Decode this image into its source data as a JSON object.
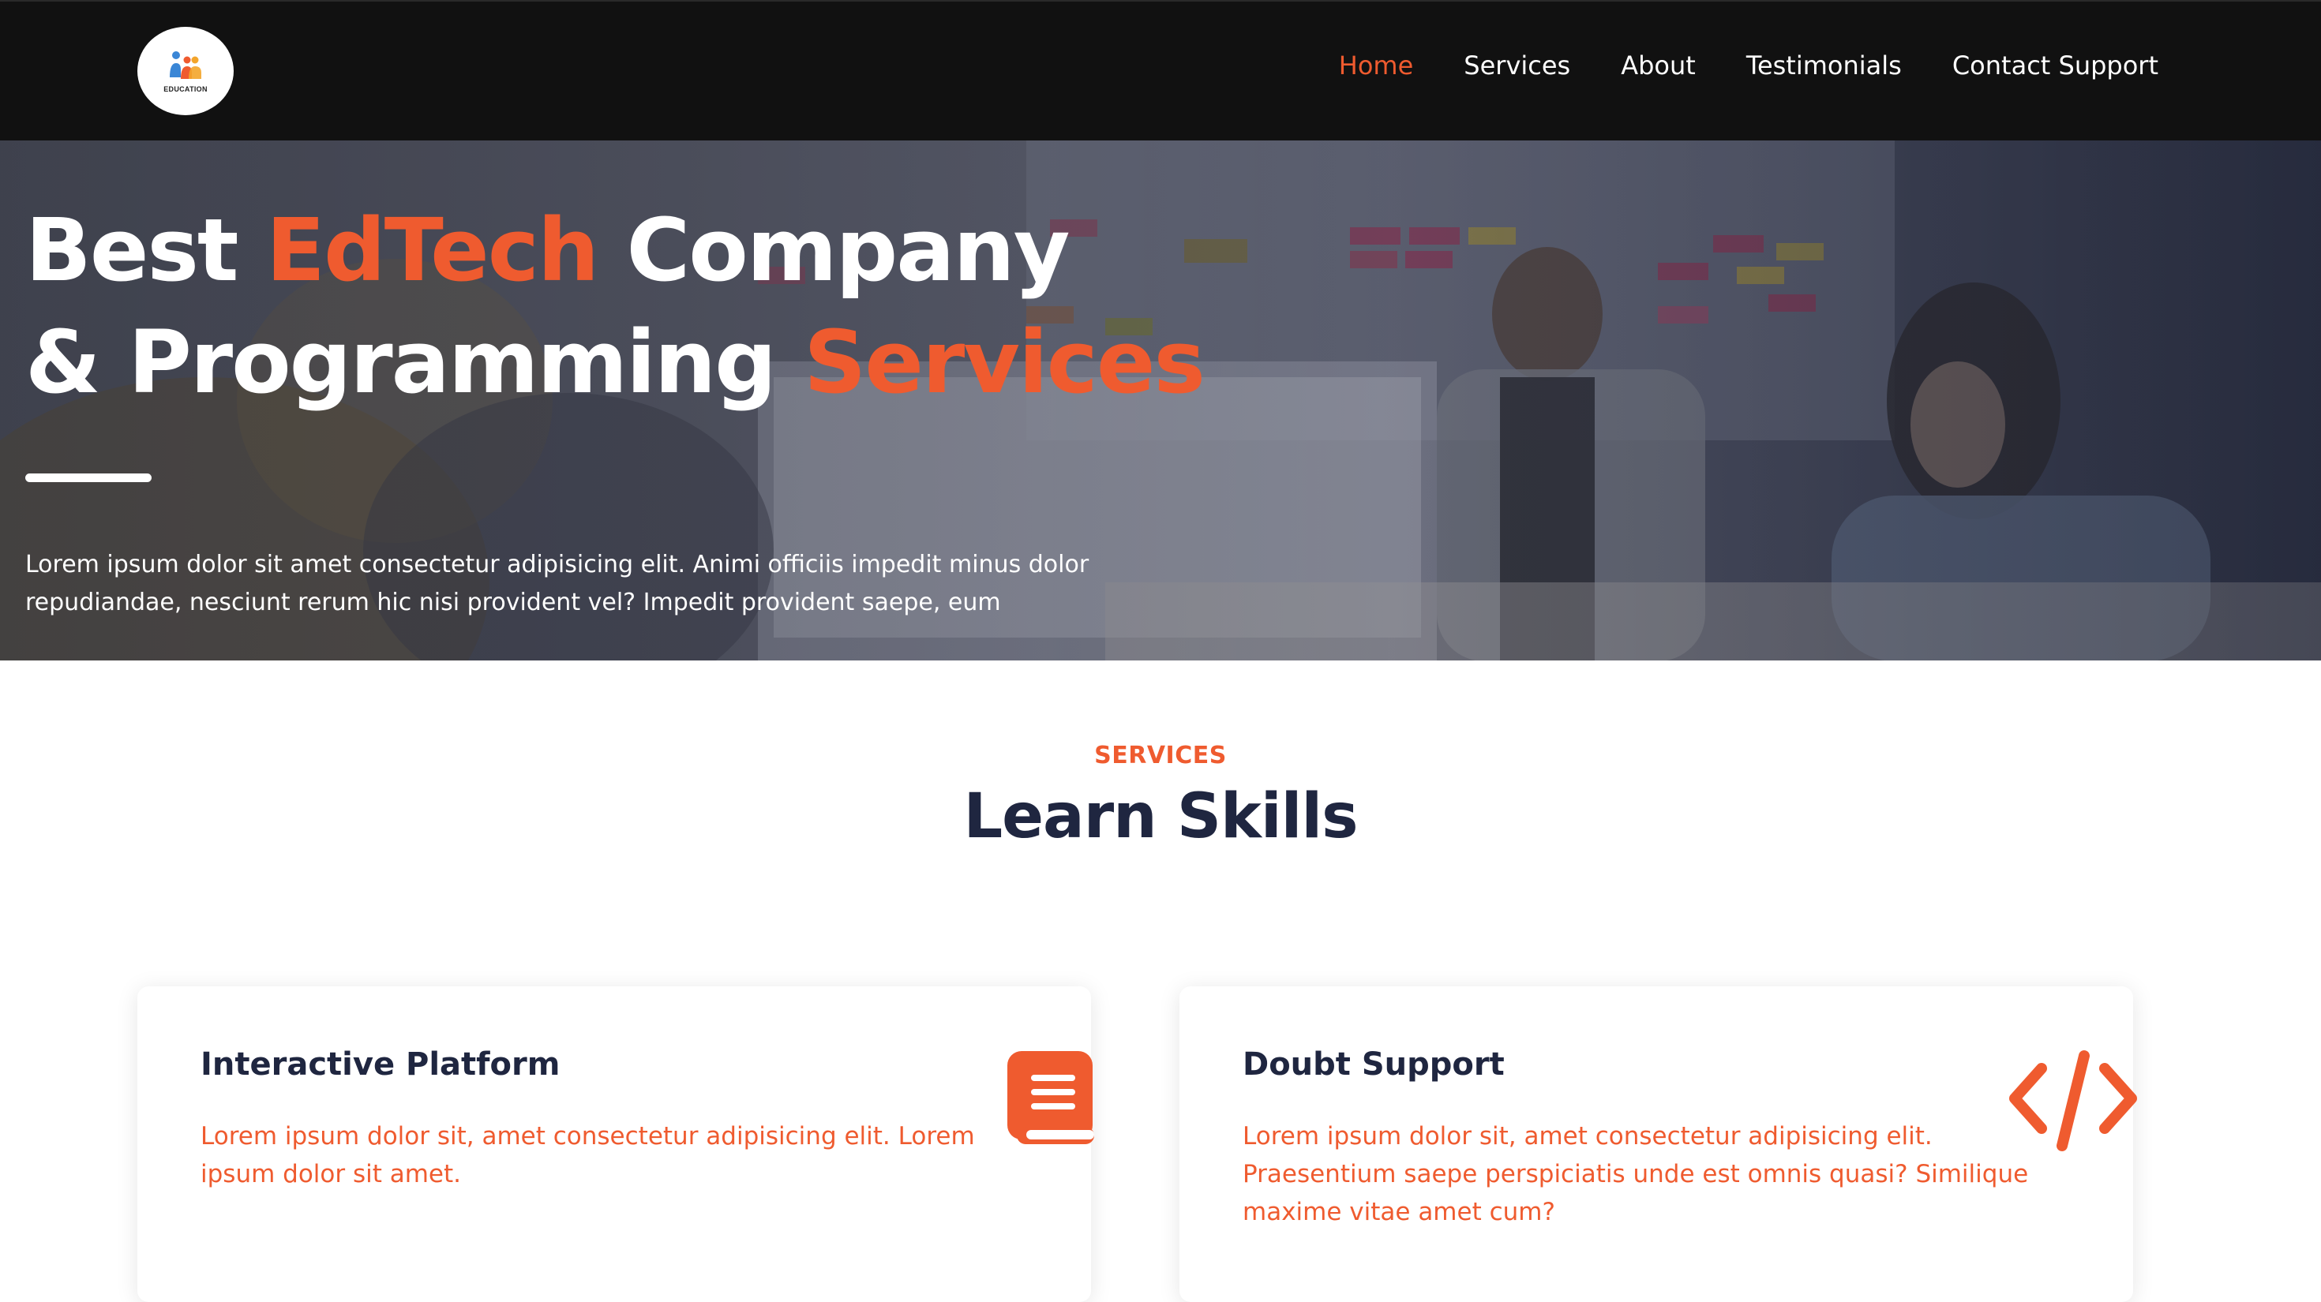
{
  "brand": {
    "logo_text": "EDUCATION"
  },
  "nav": {
    "items": [
      {
        "label": "Home",
        "active": true
      },
      {
        "label": "Services",
        "active": false
      },
      {
        "label": "About",
        "active": false
      },
      {
        "label": "Testimonials",
        "active": false
      },
      {
        "label": "Contact Support",
        "active": false
      }
    ]
  },
  "hero": {
    "title_line1_a": "Best ",
    "title_line1_accent": "EdTech",
    "title_line1_b": " Company",
    "title_line2_a": "& Programming ",
    "title_line2_accent": "Services",
    "description": "Lorem ipsum dolor sit amet consectetur adipisicing elit. Animi officiis impedit minus dolor repudiandae, nesciunt rerum hic nisi provident vel? Impedit provident saepe, eum"
  },
  "services": {
    "tag": "SERVICES",
    "title": "Learn Skills",
    "cards": [
      {
        "title": "Interactive Platform",
        "text": "Lorem ipsum dolor sit, amet consectetur adipisicing elit. Lorem ipsum dolor sit amet.",
        "icon": "book-icon"
      },
      {
        "title": "Doubt Support",
        "text": "Lorem ipsum dolor sit, amet consectetur adipisicing elit. Praesentium saepe perspiciatis unde est omnis quasi? Similique maxime vitae amet cum?",
        "icon": "code-icon"
      }
    ]
  },
  "colors": {
    "accent": "#ef5b2f",
    "navbar_bg": "#111111",
    "heading_dark": "#1f2640"
  }
}
